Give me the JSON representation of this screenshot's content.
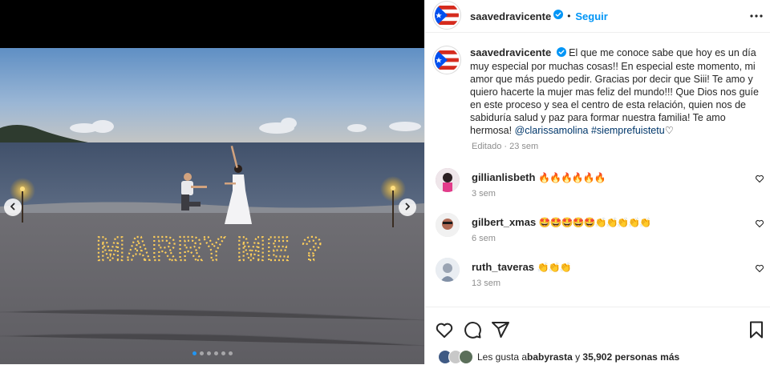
{
  "post_image": {
    "sand_message": "MARRY ME ?",
    "carousel_dots": 6,
    "active_dot": 0
  },
  "header": {
    "username": "saavedravicente",
    "separator": "•",
    "follow_label": "Seguir",
    "more_icon": "more-horizontal-icon"
  },
  "caption": {
    "username": "saavedravicente",
    "text": "El que me conoce sabe que hoy es un día muy especial por muchas cosas!! En especial este momento, mi amor que más puedo pedir. Gracias por decir que Siii! Te amo y quiero hacerte la mujer mas feliz del mundo!!! Que Dios nos guíe en este proceso y sea el centro de esta relación, quien nos de sabiduría salud y paz para formar nuestra familia! Te amo hermosa! ",
    "mention": "@clarissamolina",
    "hashtag": "#siemprefuistetu",
    "trailing_emoji": "♡",
    "meta": "Editado · 23 sem"
  },
  "comments": [
    {
      "username": "gillianlisbeth",
      "text": "🔥🔥🔥🔥🔥🔥",
      "time": "3 sem",
      "avatar_color": "#c9a3b7"
    },
    {
      "username": "gilbert_xmas",
      "text": "🤩🤩🤩🤩🤩👏👏👏👏👏",
      "time": "6 sem",
      "avatar_color": "#b06a55"
    },
    {
      "username": "ruth_taveras",
      "text": "👏👏👏",
      "time": "13 sem",
      "avatar_color": "#9aa4b3"
    }
  ],
  "actions": {
    "like_icon": "heart-icon",
    "comment_icon": "comment-icon",
    "share_icon": "share-icon",
    "save_icon": "bookmark-icon"
  },
  "likes": {
    "prefix": "Les gusta a ",
    "user": "babyrasta",
    "middle": " y ",
    "count": "35,902",
    "suffix": " personas más"
  },
  "colors": {
    "accent": "#0095f6",
    "verified": "#0095f6",
    "link": "#00376b",
    "secondary_text": "#8e8e8e"
  }
}
